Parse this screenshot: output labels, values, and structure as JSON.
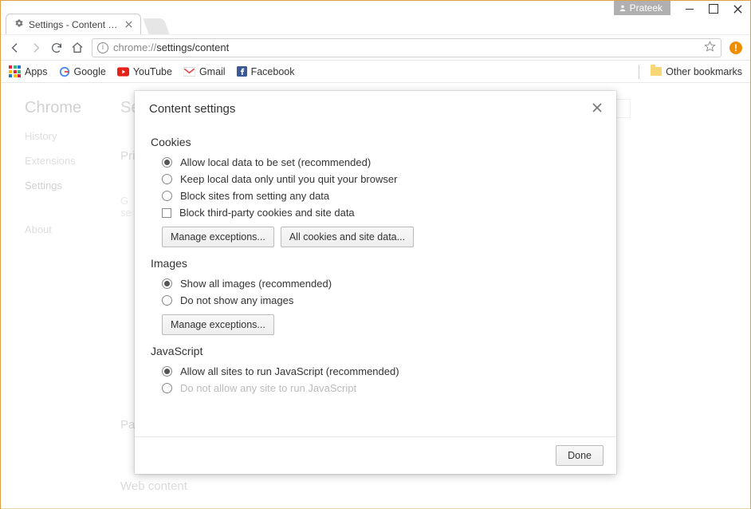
{
  "window": {
    "user_name": "Prateek"
  },
  "tab": {
    "title": "Settings - Content settin"
  },
  "url": {
    "scheme": "chrome://",
    "rest": "settings/content"
  },
  "bookmarks": {
    "apps": "Apps",
    "google": "Google",
    "youtube": "YouTube",
    "gmail": "Gmail",
    "facebook": "Facebook",
    "other": "Other bookmarks"
  },
  "page": {
    "heading": "Chrome",
    "nav": {
      "history": "History",
      "extensions": "Extensions",
      "settings": "Settings",
      "about": "About"
    },
    "mid_title": "Settings",
    "sections": {
      "privacy": "Privacy",
      "passwords": "Passwords and forms",
      "webcontent": "Web content"
    },
    "letters": {
      "g": "G",
      "s": "se"
    }
  },
  "dialog": {
    "title": "Content settings",
    "cookies": {
      "heading": "Cookies",
      "opt1": "Allow local data to be set (recommended)",
      "opt2": "Keep local data only until you quit your browser",
      "opt3": "Block sites from setting any data",
      "opt4": "Block third-party cookies and site data",
      "btn_exceptions": "Manage exceptions...",
      "btn_alldata": "All cookies and site data..."
    },
    "images": {
      "heading": "Images",
      "opt1": "Show all images (recommended)",
      "opt2": "Do not show any images",
      "btn_exceptions": "Manage exceptions..."
    },
    "javascript": {
      "heading": "JavaScript",
      "opt1": "Allow all sites to run JavaScript (recommended)",
      "opt2": "Do not allow any site to run JavaScript"
    },
    "footer": {
      "done": "Done"
    }
  }
}
